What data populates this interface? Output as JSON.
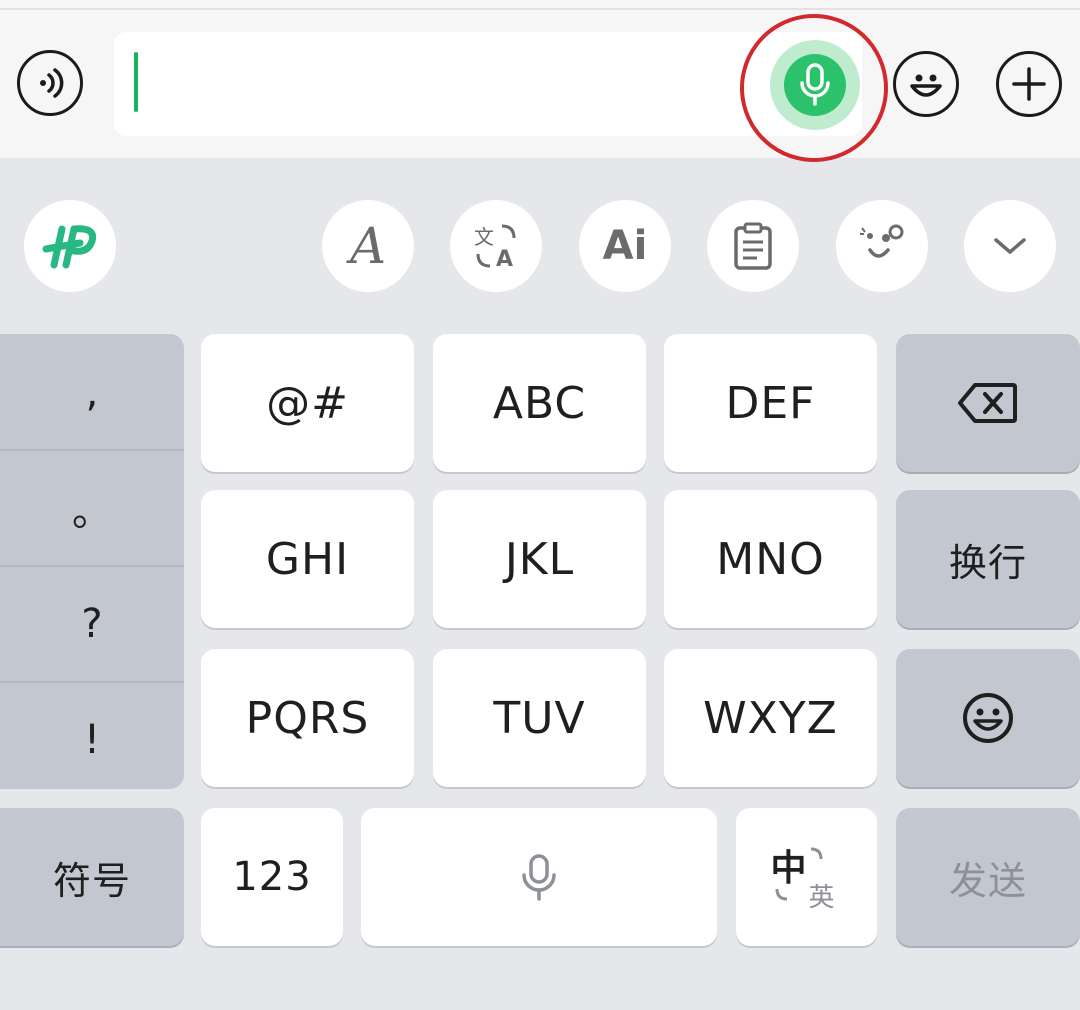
{
  "input_bar": {
    "voice_mode_icon": "speaker-voice-icon",
    "text_value": "",
    "voice_input_icon": "microphone-icon",
    "emoji_icon": "smiley-face-icon",
    "add_icon": "plus-icon"
  },
  "toolbar": {
    "logo_icon": "keyboard-brand-logo-icon",
    "items": [
      {
        "name": "handwriting-font-icon",
        "glyph": "A"
      },
      {
        "name": "translate-icon"
      },
      {
        "name": "ai-assistant-icon",
        "glyph": "Ai"
      },
      {
        "name": "clipboard-icon"
      },
      {
        "name": "sticker-face-icon"
      },
      {
        "name": "collapse-chevron-icon"
      }
    ]
  },
  "punctuation": [
    ",",
    "。",
    "?",
    "!"
  ],
  "t9_keys": [
    [
      "@#",
      "ABC",
      "DEF"
    ],
    [
      "GHI",
      "JKL",
      "MNO"
    ],
    [
      "PQRS",
      "TUV",
      "WXYZ"
    ]
  ],
  "right_keys": {
    "backspace_icon": "backspace-icon",
    "newline": "换行",
    "emoji_icon": "smiley-face-icon"
  },
  "bottom_row": {
    "symbols": "符号",
    "numbers": "123",
    "space_icon": "microphone-icon",
    "lang_main": "中",
    "lang_sub": "英",
    "send": "发送"
  },
  "colors": {
    "accent_green": "#2bc26b",
    "highlight_ring": "#d2292f",
    "key_bg": "#ffffff",
    "function_key_bg": "#c3c7cf",
    "keyboard_bg": "#e6e7eb"
  }
}
